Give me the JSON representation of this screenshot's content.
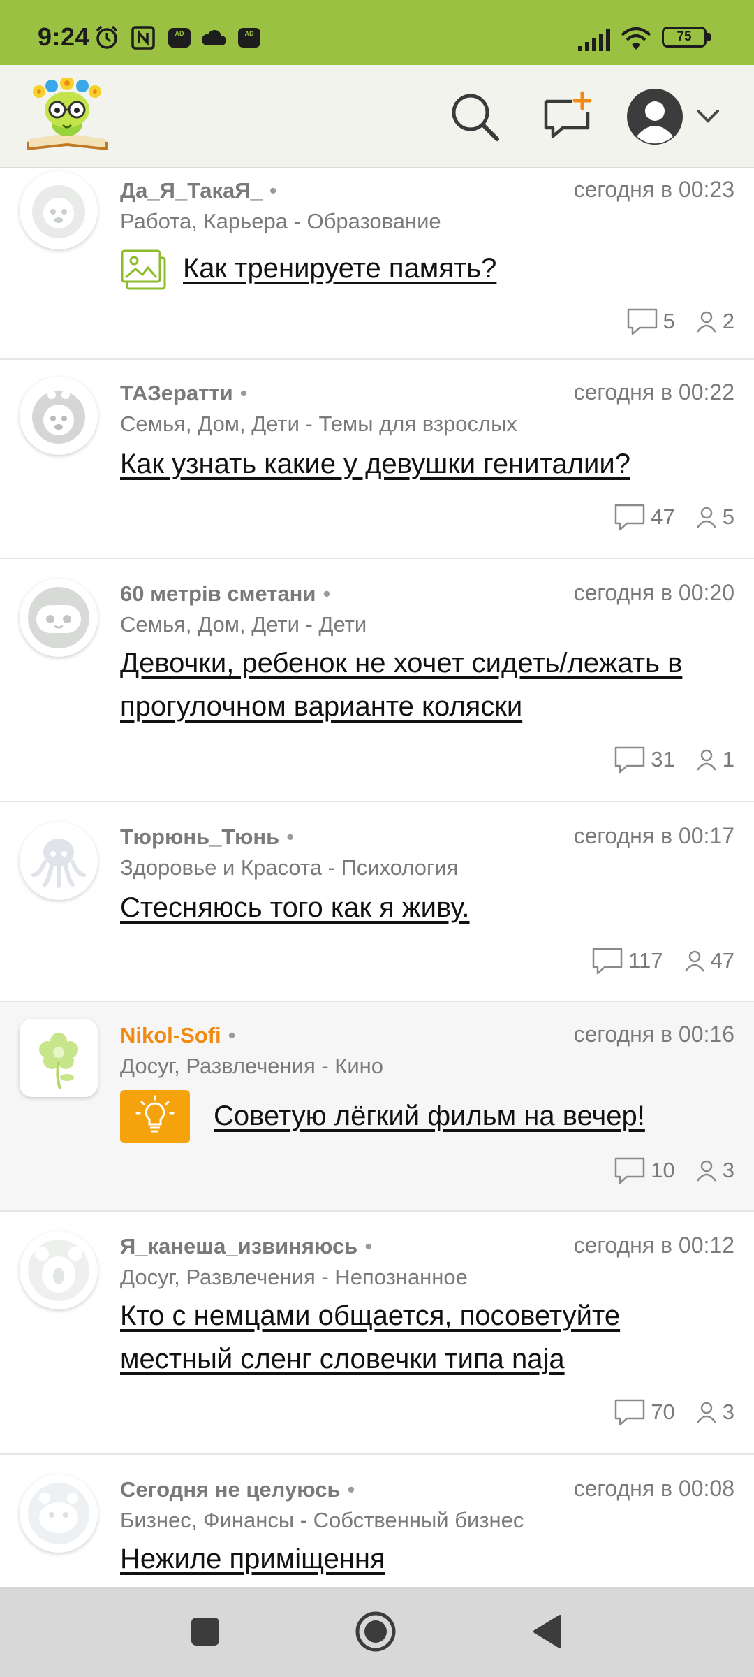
{
  "status_bar": {
    "time": "9:24",
    "battery": "75",
    "badges": [
      "AD",
      "AD"
    ],
    "icons": [
      "alarm-icon",
      "nfc-icon",
      "adblocker-icon",
      "cloud-icon",
      "adblocker-icon",
      "signal-icon",
      "wifi-icon",
      "battery-icon"
    ]
  },
  "header": {
    "logo": "site-logo",
    "icons": [
      "search-icon",
      "new-question-icon",
      "profile-icon",
      "chevron-down-icon"
    ]
  },
  "colors": {
    "status_bar": "#9ac141",
    "header_bg": "#f2f3ec",
    "accent_orange": "#f08a12",
    "icon_green": "#8cbb2e"
  },
  "posts": [
    {
      "author": "Да_Я_ТакаЯ_",
      "time": "сегодня в 00:23",
      "category": "Работа, Карьера - Образование",
      "title": "Как тренируете память?",
      "comments": "5",
      "users": "2",
      "title_icon": "image-icon"
    },
    {
      "author": "ТАЗератти",
      "time": "сегодня в 00:22",
      "category": "Семья, Дом, Дети - Темы для взрослых",
      "title": "Как узнать какие у девушки гениталии?",
      "comments": "47",
      "users": "5"
    },
    {
      "author": "60 метрів сметани",
      "time": "сегодня в 00:20",
      "category": "Семья, Дом, Дети - Дети",
      "title": "Девочки, ребенок не хочет сидеть/лежать в прогулочном варианте коляски",
      "comments": "31",
      "users": "1"
    },
    {
      "author": "Тюрюнь_Тюнь",
      "time": "сегодня в 00:17",
      "category": "Здоровье и Красота - Психология",
      "title": "Стесняюсь того как я живу.",
      "comments": "117",
      "users": "47"
    },
    {
      "author": "Nikol-Sofi",
      "time": "сегодня в 00:16",
      "category": "Досуг, Развлечения - Кино",
      "title": "Советую лёгкий фильм на вечер!",
      "comments": "10",
      "users": "3",
      "title_icon": "lightbulb-icon"
    },
    {
      "author": "Я_канеша_извиняюсь",
      "time": "сегодня в 00:12",
      "category": "Досуг, Развлечения - Непознанное",
      "title": "Кто с немцами общается, посоветуйте местный сленг словечки типа naja",
      "comments": "70",
      "users": "3"
    },
    {
      "author": "Сегодня не целуюсь",
      "time": "сегодня в 00:08",
      "category": "Бизнес, Финансы - Собственный бизнес",
      "title": "Нежиле приміщення"
    }
  ],
  "nav_bar": {
    "icons": [
      "recents-icon",
      "home-icon",
      "back-icon"
    ]
  }
}
